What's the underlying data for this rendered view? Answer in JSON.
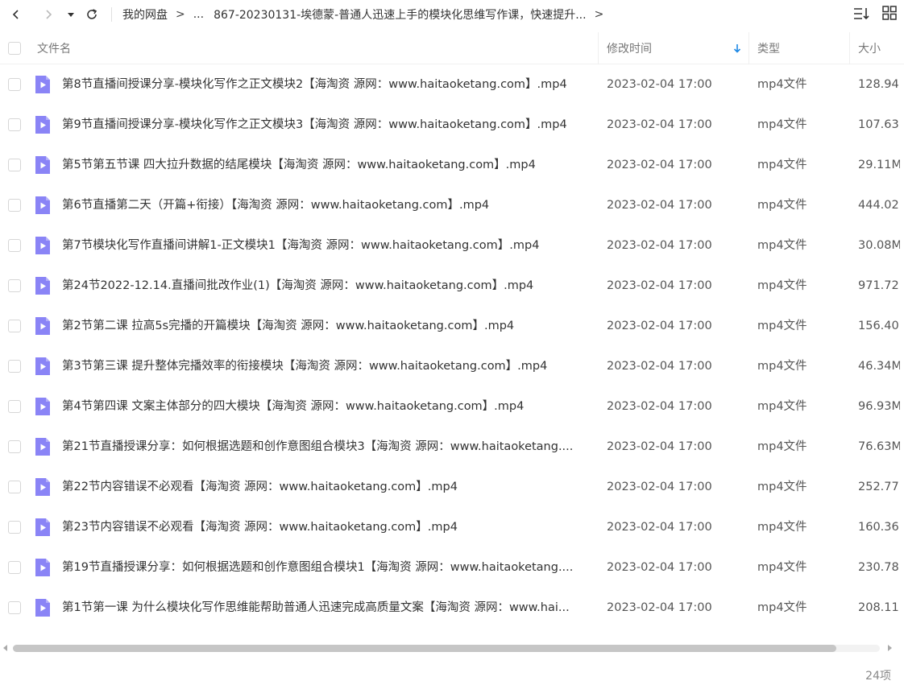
{
  "toolbar": {
    "breadcrumb": [
      "我的网盘",
      "...",
      "867-20230131-埃德蒙-普通人迅速上手的模块化思维写作课，快速提升..."
    ],
    "separator": ">"
  },
  "header": {
    "name_label": "文件名",
    "date_label": "修改时间",
    "type_label": "类型",
    "size_label": "大小"
  },
  "files": [
    {
      "name": "第8节直播间授课分享-模块化写作之正文模块2【海淘资 源网：www.haitaoketang.com】.mp4",
      "date": "2023-02-04 17:00",
      "type": "mp4文件",
      "size": "128.94"
    },
    {
      "name": "第9节直播间授课分享-模块化写作之正文模块3【海淘资 源网：www.haitaoketang.com】.mp4",
      "date": "2023-02-04 17:00",
      "type": "mp4文件",
      "size": "107.63"
    },
    {
      "name": "第5节第五节课 四大拉升数据的结尾模块【海淘资 源网：www.haitaoketang.com】.mp4",
      "date": "2023-02-04 17:00",
      "type": "mp4文件",
      "size": "29.11M"
    },
    {
      "name": "第6节直播第二天（开篇+衔接）【海淘资 源网：www.haitaoketang.com】.mp4",
      "date": "2023-02-04 17:00",
      "type": "mp4文件",
      "size": "444.02"
    },
    {
      "name": "第7节模块化写作直播间讲解1-正文模块1【海淘资 源网：www.haitaoketang.com】.mp4",
      "date": "2023-02-04 17:00",
      "type": "mp4文件",
      "size": "30.08M"
    },
    {
      "name": "第24节2022-12.14.直播间批改作业(1)【海淘资 源网：www.haitaoketang.com】.mp4",
      "date": "2023-02-04 17:00",
      "type": "mp4文件",
      "size": "971.72"
    },
    {
      "name": "第2节第二课 拉高5s完播的开篇模块【海淘资 源网：www.haitaoketang.com】.mp4",
      "date": "2023-02-04 17:00",
      "type": "mp4文件",
      "size": "156.40"
    },
    {
      "name": "第3节第三课 提升整体完播效率的衔接模块【海淘资 源网：www.haitaoketang.com】.mp4",
      "date": "2023-02-04 17:00",
      "type": "mp4文件",
      "size": "46.34M"
    },
    {
      "name": "第4节第四课 文案主体部分的四大模块【海淘资 源网：www.haitaoketang.com】.mp4",
      "date": "2023-02-04 17:00",
      "type": "mp4文件",
      "size": "96.93M"
    },
    {
      "name": "第21节直播授课分享：如何根据选题和创作意图组合模块3【海淘资 源网：www.haitaoketang....",
      "date": "2023-02-04 17:00",
      "type": "mp4文件",
      "size": "76.63M"
    },
    {
      "name": "第22节内容错误不必观看【海淘资 源网：www.haitaoketang.com】.mp4",
      "date": "2023-02-04 17:00",
      "type": "mp4文件",
      "size": "252.77"
    },
    {
      "name": "第23节内容错误不必观看【海淘资 源网：www.haitaoketang.com】.mp4",
      "date": "2023-02-04 17:00",
      "type": "mp4文件",
      "size": "160.36"
    },
    {
      "name": "第19节直播授课分享：如何根据选题和创作意图组合模块1【海淘资 源网：www.haitaoketang....",
      "date": "2023-02-04 17:00",
      "type": "mp4文件",
      "size": "230.78"
    },
    {
      "name": "第1节第一课 为什么模块化写作思维能帮助普通人迅速完成高质量文案【海淘资 源网：www.hai...",
      "date": "2023-02-04 17:00",
      "type": "mp4文件",
      "size": "208.11"
    }
  ],
  "status": {
    "count": "24项"
  },
  "scroll": {
    "visible_fraction": 0.95
  },
  "colors": {
    "file_icon": "#8a84f6",
    "sort_arrow": "#1e88e5"
  }
}
